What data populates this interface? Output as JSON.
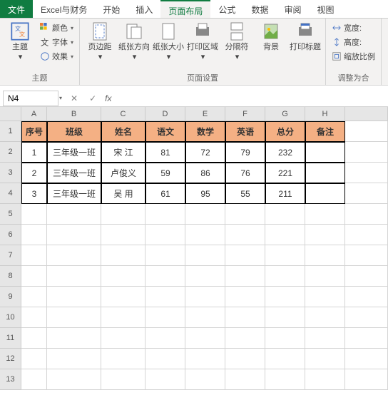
{
  "tabs": {
    "file": "文件",
    "ef": "Excel与财务",
    "start": "开始",
    "insert": "插入",
    "layout": "页面布局",
    "formula": "公式",
    "data": "数据",
    "review": "审阅",
    "view": "视图"
  },
  "ribbon": {
    "theme_group": "主题",
    "theme": "主题",
    "colors": "颜色",
    "fonts": "字体",
    "effects": "效果",
    "page_group": "页面设置",
    "margins": "页边距",
    "orient": "纸张方向",
    "size": "纸张大小",
    "area": "打印区域",
    "breaks": "分隔符",
    "bg": "背景",
    "titles": "打印标题",
    "fit_group": "调整为合",
    "width": "宽度:",
    "height": "高度:",
    "scale": "缩放比例"
  },
  "namebox": "N4",
  "col_letters": [
    "A",
    "B",
    "C",
    "D",
    "E",
    "F",
    "G",
    "H"
  ],
  "row_nums": [
    "1",
    "2",
    "3",
    "4",
    "5",
    "6",
    "7",
    "8",
    "9",
    "10",
    "11",
    "12",
    "13"
  ],
  "headers": {
    "c0": "序号",
    "c1": "班级",
    "c2": "姓名",
    "c3": "语文",
    "c4": "数学",
    "c5": "英语",
    "c6": "总分",
    "c7": "备注"
  },
  "rows": [
    {
      "c0": "1",
      "c1": "三年级一班",
      "c2": "宋  江",
      "c3": "81",
      "c4": "72",
      "c5": "79",
      "c6": "232",
      "c7": ""
    },
    {
      "c0": "2",
      "c1": "三年级一班",
      "c2": "卢俊义",
      "c3": "59",
      "c4": "86",
      "c5": "76",
      "c6": "221",
      "c7": ""
    },
    {
      "c0": "3",
      "c1": "三年级一班",
      "c2": "吴  用",
      "c3": "61",
      "c4": "95",
      "c5": "55",
      "c6": "211",
      "c7": ""
    }
  ]
}
